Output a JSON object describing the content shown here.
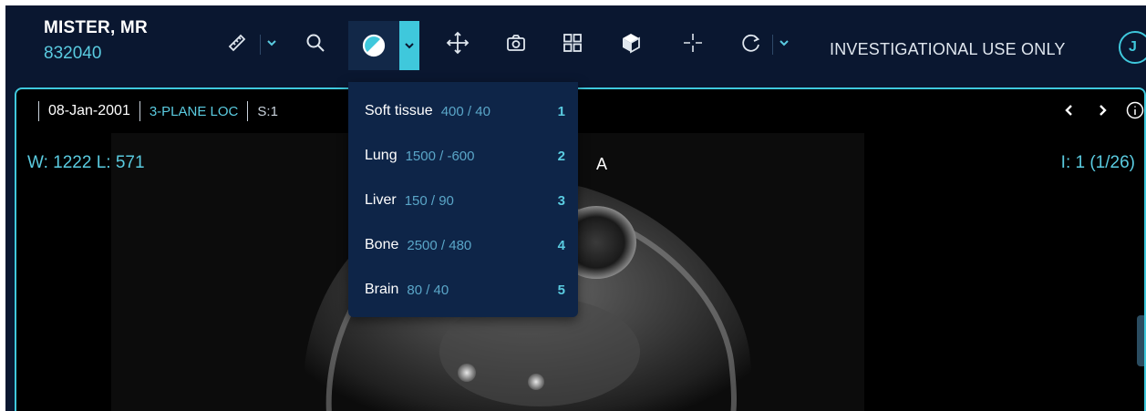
{
  "patient": {
    "name": "MISTER, MR",
    "id": "832040"
  },
  "toolbar": {
    "tools": [
      {
        "name": "measure",
        "icon": "ruler-icon"
      },
      {
        "name": "zoom",
        "icon": "search-icon"
      },
      {
        "name": "window-level",
        "icon": "contrast-icon",
        "active": true
      },
      {
        "name": "pan",
        "icon": "move-icon"
      },
      {
        "name": "capture",
        "icon": "camera-icon"
      },
      {
        "name": "layout",
        "icon": "grid-layout-icon"
      },
      {
        "name": "mpr",
        "icon": "cube-icon"
      },
      {
        "name": "crosshairs",
        "icon": "crosshair-icon"
      },
      {
        "name": "reset",
        "icon": "rotate-icon"
      }
    ],
    "notice": "INVESTIGATIONAL USE ONLY",
    "user_initial": "J"
  },
  "viewport": {
    "date": "08-Jan-2001",
    "series": "3-PLANE LOC",
    "slice": "S:1",
    "window_level": "W: 1222 L: 571",
    "orientation": "A",
    "image_index": "I: 1 (1/26)"
  },
  "presets": [
    {
      "name": "Soft tissue",
      "value": "400 / 40",
      "key": "1"
    },
    {
      "name": "Lung",
      "value": "1500 / -600",
      "key": "2"
    },
    {
      "name": "Liver",
      "value": "150 / 90",
      "key": "3"
    },
    {
      "name": "Bone",
      "value": "2500 / 480",
      "key": "4"
    },
    {
      "name": "Brain",
      "value": "80 / 40",
      "key": "5"
    }
  ],
  "colors": {
    "background": "#0a1730",
    "accent": "#3fc8dc",
    "dropdown": "#0e2548"
  }
}
